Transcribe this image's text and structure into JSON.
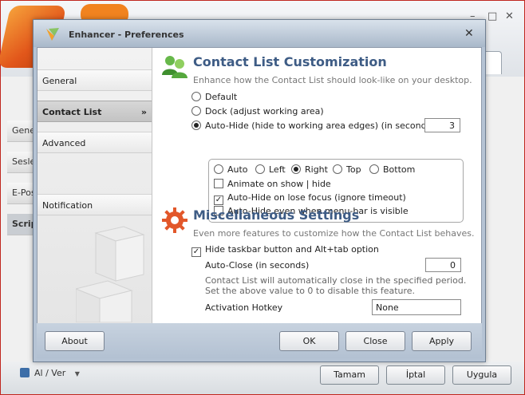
{
  "host": {
    "sidebar": [
      "Gene",
      "Sesle",
      "E-Pos",
      "Scrip"
    ],
    "footer_link": "Al / Ver",
    "buttons": {
      "ok": "Tamam",
      "cancel": "İptal",
      "apply": "Uygula"
    },
    "controls": {
      "min": "–",
      "max": "□",
      "close": "✕"
    }
  },
  "dialog": {
    "title": "Enhancer - Preferences",
    "close_glyph": "✕",
    "nav": [
      {
        "label": "General"
      },
      {
        "label": "Contact List",
        "selected": true,
        "arrow": "»"
      },
      {
        "label": "Advanced"
      },
      {
        "label": "Notification"
      }
    ],
    "contact_list": {
      "heading": "Contact List Customization",
      "subtitle": "Enhance how the Contact List should look-like on your desktop.",
      "options": {
        "default": "Default",
        "dock": "Dock (adjust working area)",
        "autohide": "Auto-Hide (hide to working area edges) (in seconds)"
      },
      "selected_option": "autohide",
      "autohide_seconds": "3",
      "edges": [
        "Auto",
        "Left",
        "Right",
        "Top",
        "Bottom"
      ],
      "selected_edge": "Right",
      "animate": {
        "label": "Animate on show | hide",
        "checked": false
      },
      "lose_focus": {
        "label": "Auto-Hide on lose focus (ignore timeout)",
        "checked": true
      },
      "menubar": {
        "label": "Auto-Hide even when menu-bar is visible",
        "checked": false
      }
    },
    "misc": {
      "heading": "Miscellaneous Settings",
      "subtitle": "Even more features to customize how the Contact List behaves.",
      "hide_taskbar": {
        "label": "Hide taskbar button and Alt+tab option",
        "checked": true
      },
      "auto_close_label": "Auto-Close (in seconds)",
      "auto_close_value": "0",
      "note_line1": "Contact List will automatically close in the specified period.",
      "note_line2": "Set the above value to 0 to disable this feature.",
      "hotkey_label": "Activation Hotkey",
      "hotkey_value": "None"
    },
    "buttons": {
      "about": "About",
      "ok": "OK",
      "close": "Close",
      "apply": "Apply"
    }
  },
  "colors": {
    "heading": "#3e5c85",
    "frame": "#b5c3d4",
    "border": "#c0261e"
  }
}
